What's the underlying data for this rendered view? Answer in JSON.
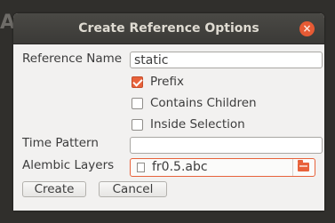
{
  "background": {
    "partial_letter": "A"
  },
  "dialog": {
    "title": "Create Reference Options",
    "close_glyph": "×",
    "colors": {
      "accent": "#e8623b",
      "titlebar": "#3c3b37",
      "body": "#f2f1f0"
    }
  },
  "form": {
    "reference_name": {
      "label": "Reference Name",
      "value": "static"
    },
    "options": [
      {
        "label": "Prefix",
        "checked": true
      },
      {
        "label": "Contains Children",
        "checked": false
      },
      {
        "label": "Inside Selection",
        "checked": false
      }
    ],
    "time_pattern": {
      "label": "Time Pattern",
      "value": ""
    },
    "alembic_layers": {
      "label": "Alembic Layers",
      "file": "fr0.5.abc",
      "file_icon": "document-icon",
      "browse_icon": "folder-icon"
    }
  },
  "buttons": {
    "create": "Create",
    "cancel": "Cancel"
  }
}
